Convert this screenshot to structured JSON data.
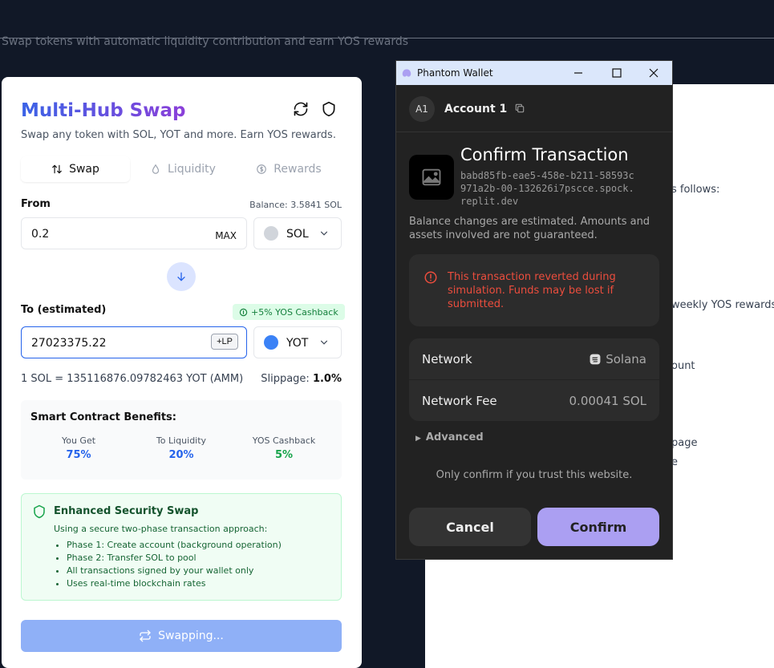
{
  "page": {
    "subtitle": "Swap tokens with automatic liquidity contribution and earn YOS rewards"
  },
  "background_panel": {
    "fragments": [
      "s follows:",
      "weekly YOS rewards:",
      "ount",
      "page",
      "e"
    ]
  },
  "swap_card": {
    "title": "Multi-Hub Swap",
    "subtitle": "Swap any token with SOL, YOT and more. Earn YOS rewards.",
    "tabs": [
      {
        "label": "Swap",
        "icon": "swap-arrows-icon",
        "active": true
      },
      {
        "label": "Liquidity",
        "icon": "droplet-icon",
        "active": false
      },
      {
        "label": "Rewards",
        "icon": "dollar-coin-icon",
        "active": false
      }
    ],
    "from": {
      "label": "From",
      "balance": "Balance: 3.5841 SOL",
      "amount": "0.2",
      "max_label": "MAX",
      "token": "SOL"
    },
    "to": {
      "label": "To (estimated)",
      "cashback_badge": "+5% YOS Cashback",
      "amount": "27023375.22",
      "lp_label": "+LP",
      "token": "YOT"
    },
    "rate": "1 SOL = 135116876.09782463 YOT (AMM)",
    "slippage_label": "Slippage:",
    "slippage_value": "1.0%",
    "benefits": {
      "heading": "Smart Contract Benefits:",
      "items": [
        {
          "label": "You Get",
          "value": "75%",
          "color": "#2563eb"
        },
        {
          "label": "To Liquidity",
          "value": "20%",
          "color": "#2563eb"
        },
        {
          "label": "YOS Cashback",
          "value": "5%",
          "color": "#16a34a"
        }
      ]
    },
    "security": {
      "heading": "Enhanced Security Swap",
      "intro": "Using a secure two-phase transaction approach:",
      "bullets": [
        "Phase 1: Create account (background operation)",
        "Phase 2: Transfer SOL to pool",
        "All transactions signed by your wallet only",
        "Uses real-time blockchain rates"
      ]
    },
    "swap_button": "Swapping..."
  },
  "wallet": {
    "window_title": "Phantom Wallet",
    "account_initials": "A1",
    "account_name": "Account 1",
    "heading": "Confirm Transaction",
    "origin": "babd85fb-eae5-458e-b211-58593c971a2b-00-132626i7pscce.spock.replit.dev",
    "balance_note": "Balance changes are estimated. Amounts and assets involved are not guaranteed.",
    "warning": "This transaction reverted during simulation. Funds may be lost if submitted.",
    "network_label": "Network",
    "network_value": "Solana",
    "fee_label": "Network Fee",
    "fee_value": "0.00041 SOL",
    "advanced_label": "Advanced",
    "trust_note": "Only confirm if you trust this website.",
    "cancel_label": "Cancel",
    "confirm_label": "Confirm",
    "colors": {
      "accent": "#ab9ff2",
      "warning": "#eb4d3d"
    }
  }
}
